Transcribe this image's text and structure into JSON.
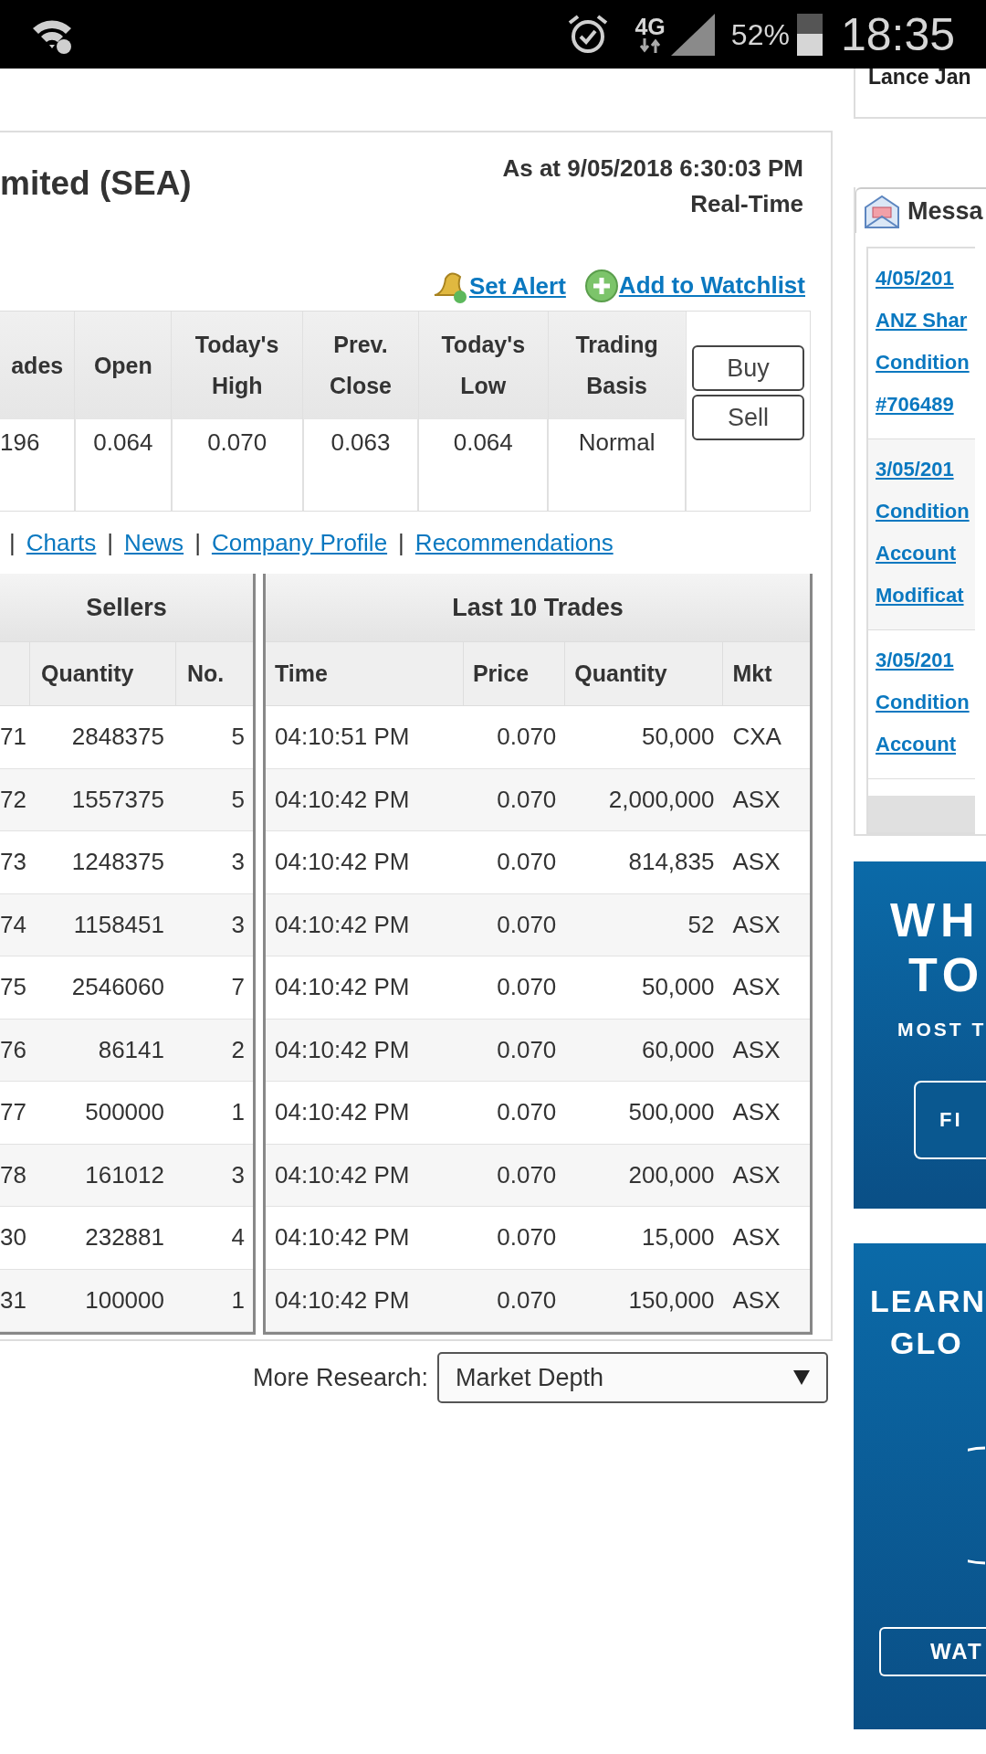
{
  "status_bar": {
    "network": "4G",
    "battery": "52%",
    "time": "18:35"
  },
  "account_name": "Lance Jan",
  "quote": {
    "title": "mited (SEA)",
    "as_at": "As at 9/05/2018 6:30:03 PM",
    "feed": "Real-Time",
    "actions": [
      {
        "kind": "alert",
        "label": "Set Alert"
      },
      {
        "kind": "watchlist",
        "label": "Add to Watchlist"
      }
    ],
    "columns": [
      [
        "ades"
      ],
      [
        "Open"
      ],
      [
        "Today's",
        "High"
      ],
      [
        "Prev.",
        "Close"
      ],
      [
        "Today's",
        "Low"
      ],
      [
        "Trading",
        "Basis"
      ]
    ],
    "values": [
      "196",
      "0.064",
      "0.070",
      "0.063",
      "0.064",
      "Normal"
    ],
    "trade_buttons": [
      "Buy",
      "Sell"
    ]
  },
  "nav": {
    "separator": "|",
    "links": [
      "Charts",
      "News",
      "Company Profile",
      "Recommendations"
    ]
  },
  "sellers": {
    "title": "Sellers",
    "columns": [
      "",
      "Quantity",
      "No."
    ],
    "rows": [
      [
        "71",
        "2848375",
        "5"
      ],
      [
        "72",
        "1557375",
        "5"
      ],
      [
        "73",
        "1248375",
        "3"
      ],
      [
        "74",
        "1158451",
        "3"
      ],
      [
        "75",
        "2546060",
        "7"
      ],
      [
        "76",
        "86141",
        "2"
      ],
      [
        "77",
        "500000",
        "1"
      ],
      [
        "78",
        "161012",
        "3"
      ],
      [
        "30",
        "232881",
        "4"
      ],
      [
        "31",
        "100000",
        "1"
      ]
    ]
  },
  "trades": {
    "title": "Last 10 Trades",
    "columns": [
      "Time",
      "Price",
      "Quantity",
      "Mkt"
    ],
    "rows": [
      [
        "04:10:51 PM",
        "0.070",
        "50,000",
        "CXA"
      ],
      [
        "04:10:42 PM",
        "0.070",
        "2,000,000",
        "ASX"
      ],
      [
        "04:10:42 PM",
        "0.070",
        "814,835",
        "ASX"
      ],
      [
        "04:10:42 PM",
        "0.070",
        "52",
        "ASX"
      ],
      [
        "04:10:42 PM",
        "0.070",
        "50,000",
        "ASX"
      ],
      [
        "04:10:42 PM",
        "0.070",
        "60,000",
        "ASX"
      ],
      [
        "04:10:42 PM",
        "0.070",
        "500,000",
        "ASX"
      ],
      [
        "04:10:42 PM",
        "0.070",
        "200,000",
        "ASX"
      ],
      [
        "04:10:42 PM",
        "0.070",
        "15,000",
        "ASX"
      ],
      [
        "04:10:42 PM",
        "0.070",
        "150,000",
        "ASX"
      ]
    ]
  },
  "more_research": {
    "label": "More Research:",
    "value": "Market Depth"
  },
  "messages": {
    "title": "Messa",
    "items": [
      {
        "lines": [
          "4/05/201",
          "ANZ Shar",
          "Condition",
          "#706489"
        ]
      },
      {
        "lines": [
          "3/05/201",
          "Condition",
          "Account",
          "Modificat"
        ]
      },
      {
        "lines": [
          "3/05/201",
          "Condition",
          "Account"
        ]
      }
    ]
  },
  "ads": [
    {
      "kind": "offer",
      "headline": [
        "WH",
        "TO"
      ],
      "subtitle": "MOST T",
      "button": "FI"
    },
    {
      "kind": "video",
      "headline": [
        "LEARN",
        "GLO"
      ],
      "button": "WAT"
    }
  ]
}
